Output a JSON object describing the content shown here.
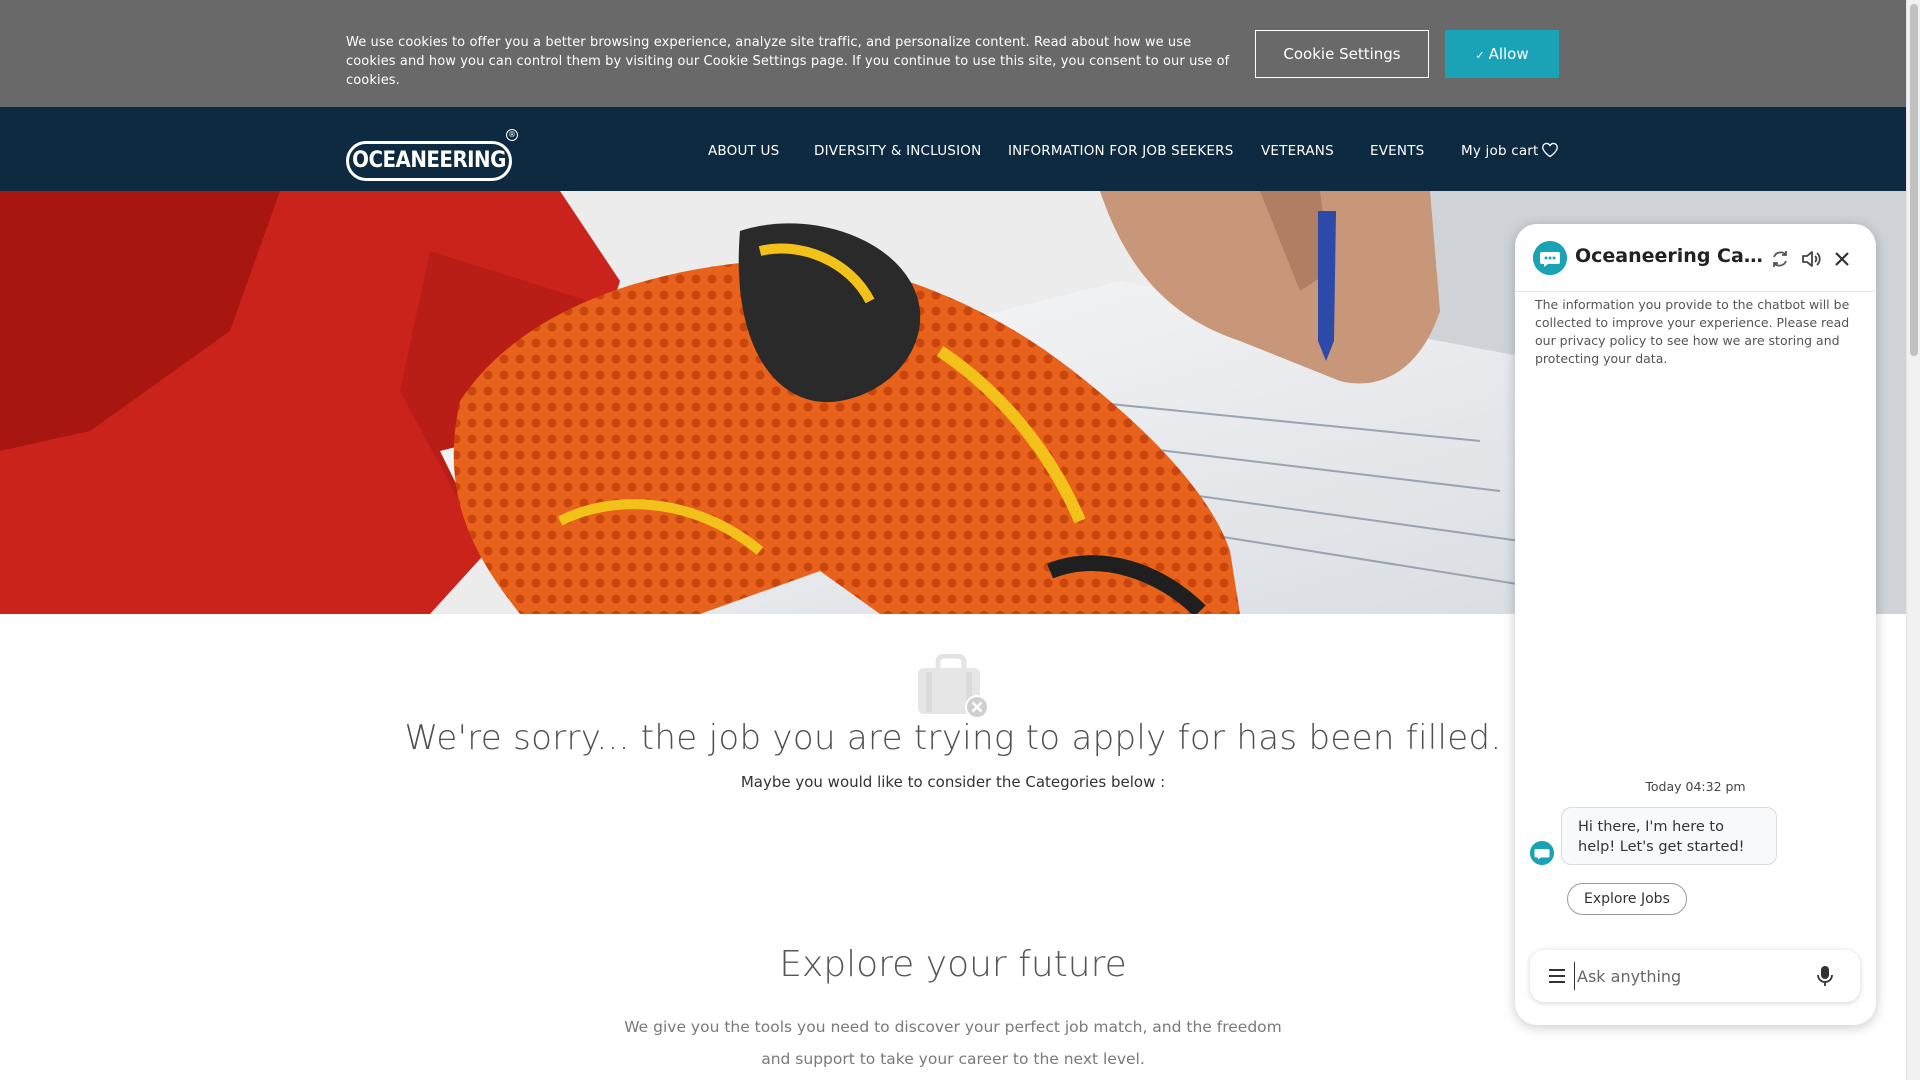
{
  "cookie": {
    "text": "We use cookies to offer you a better browsing experience, analyze site traffic, and personalize content. Read about how we use cookies and how you can control them by visiting our Cookie Settings page. If you continue to use this site, you consent to our use of cookies.",
    "settings_label": "Cookie Settings",
    "allow_label": "Allow",
    "allow_icon": "check-icon"
  },
  "nav": {
    "logo_text": "OCEANEERING",
    "logo_mark": "®",
    "items": [
      "ABOUT US",
      "DIVERSITY & INCLUSION",
      "INFORMATION FOR JOB SEEKERS",
      "VETERANS",
      "EVENTS",
      "My job cart"
    ],
    "cart_icon": "heart-icon"
  },
  "hero": {
    "image": "worker-in-orange-gloves-writing-on-paperwork"
  },
  "notice": {
    "icon": "briefcase-closed-icon",
    "title": "We're sorry... the job you are trying to apply for has been filled.",
    "subtitle": "Maybe you would like to consider the Categories below :"
  },
  "explore": {
    "title": "Explore your future",
    "body_line1": "We give you the tools you need to discover your perfect job match, and the freedom",
    "body_line2": "and support to take your career to the next level."
  },
  "chat": {
    "title": "Oceaneering Careers",
    "privacy": "The information you provide to the chatbot will be collected to improve your experience. Please read our privacy policy to see how we are storing and protecting your data.",
    "timestamp": "Today 04:32 pm",
    "message": "Hi there, I'm here to help! Let's get started!",
    "chip_label": "Explore Jobs",
    "input_placeholder": "Ask anything",
    "icons": [
      "chat-bubble-icon",
      "refresh-icon",
      "speaker-icon",
      "close-icon",
      "menu-icon",
      "microphone-icon"
    ]
  },
  "colors": {
    "accent": "#1aa3b6",
    "nav_bg": "#0e2a40",
    "cookie_bg": "#696969"
  }
}
